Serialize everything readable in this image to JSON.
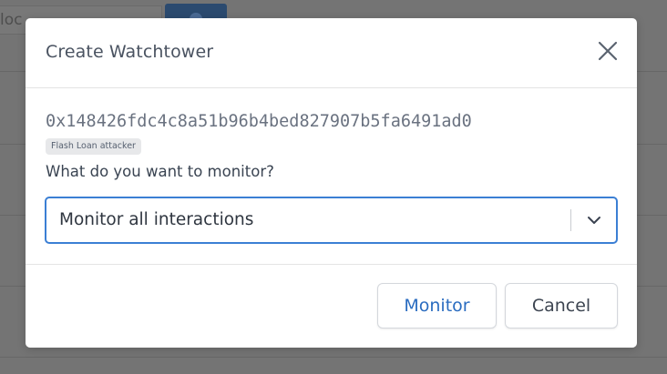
{
  "background": {
    "search_partial_text": "loc"
  },
  "modal": {
    "title": "Create Watchtower",
    "close_icon": "close-icon",
    "address": "0x148426fdc4c8a51b96b4bed827907b5fa6491ad0",
    "tag": "Flash Loan attacker",
    "question": "What do you want to monitor?",
    "select": {
      "value": "Monitor all interactions",
      "icon": "chevron-down-icon"
    },
    "buttons": {
      "monitor_label": "Monitor",
      "cancel_label": "Cancel"
    }
  },
  "colors": {
    "overlay": "#747474",
    "focus_border": "#3b7fd4",
    "primary_text": "#2a6cc0",
    "badge_bg": "#e7e8ea"
  }
}
